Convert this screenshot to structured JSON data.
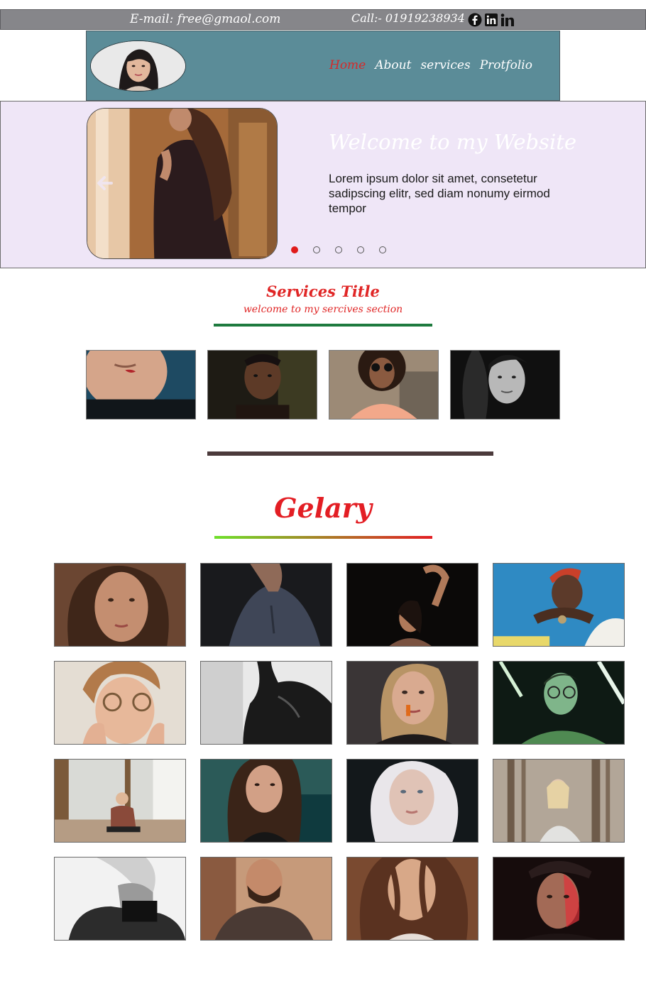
{
  "topbar": {
    "email": "E-mail: free@gmaol.com",
    "call": "Call:- 01919238934",
    "social": [
      "facebook-icon",
      "linkedin-icon",
      "linkedin-in-icon"
    ]
  },
  "nav": {
    "items": [
      {
        "label": "Home",
        "active": true
      },
      {
        "label": "About",
        "active": false
      },
      {
        "label": "services",
        "active": false
      },
      {
        "label": "Protfolio",
        "active": false
      }
    ]
  },
  "hero": {
    "title": "Welcome to my Website",
    "text": "Lorem ipsum dolor sit amet, consetetur sadipscing elitr, sed diam nonumy eirmod tempor",
    "slide_count": 5,
    "active_slide": 1
  },
  "services": {
    "title": "Services Title",
    "subtitle": "welcome to my sercives section",
    "card_count": 4
  },
  "gallery": {
    "title": "Gelary",
    "rows": 4,
    "columns": 4
  },
  "colors": {
    "topbar": "#86868a",
    "header": "#5b8c98",
    "hero_bg": "#efe6f7",
    "accent_red": "#e31e24",
    "green_line": "#1e7a3e"
  }
}
